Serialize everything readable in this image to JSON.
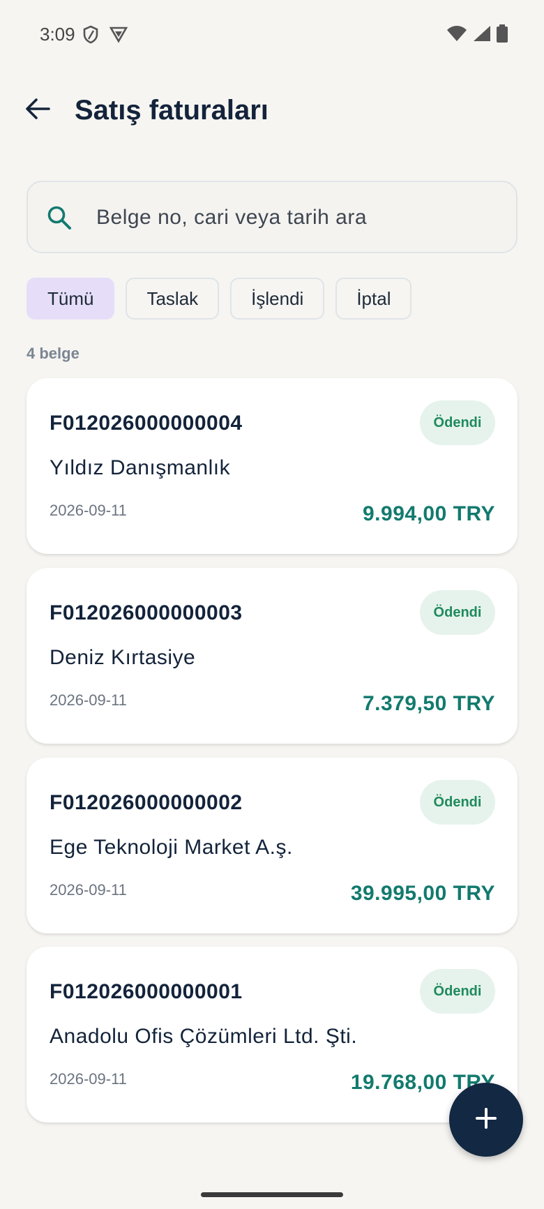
{
  "status_bar": {
    "time": "3:09",
    "icons": [
      "shield-icon",
      "vpn-icon",
      "wifi-icon",
      "signal-icon",
      "battery-icon"
    ]
  },
  "header": {
    "back_icon": "arrow-left-icon",
    "title": "Satış faturaları"
  },
  "search": {
    "icon": "search-icon",
    "placeholder": "Belge no, cari veya tarih ara",
    "value": ""
  },
  "filters": [
    {
      "label": "Tümü",
      "active": true
    },
    {
      "label": "Taslak",
      "active": false
    },
    {
      "label": "İşlendi",
      "active": false
    },
    {
      "label": "İptal",
      "active": false
    }
  ],
  "count_label": "4 belge",
  "invoices": [
    {
      "doc_no": "F012026000000004",
      "customer": "Yıldız Danışmanlık",
      "date": "2026-09-11",
      "amount": "9.994,00 TRY",
      "status": "Ödendi"
    },
    {
      "doc_no": "F012026000000003",
      "customer": "Deniz Kırtasiye",
      "date": "2026-09-11",
      "amount": "7.379,50 TRY",
      "status": "Ödendi"
    },
    {
      "doc_no": "F012026000000002",
      "customer": "Ege Teknoloji Market A.ş.",
      "date": "2026-09-11",
      "amount": "39.995,00 TRY",
      "status": "Ödendi"
    },
    {
      "doc_no": "F012026000000001",
      "customer": "Anadolu Ofis Çözümleri Ltd. Şti.",
      "date": "2026-09-11",
      "amount": "19.768,00 TRY",
      "status": "Ödendi"
    }
  ],
  "fab": {
    "icon": "plus-icon"
  },
  "colors": {
    "accent": "#127a6e",
    "badge_bg": "#e6f3ec",
    "badge_text": "#1f8a5c",
    "chip_active": "#e6def8",
    "fab": "#122843"
  }
}
